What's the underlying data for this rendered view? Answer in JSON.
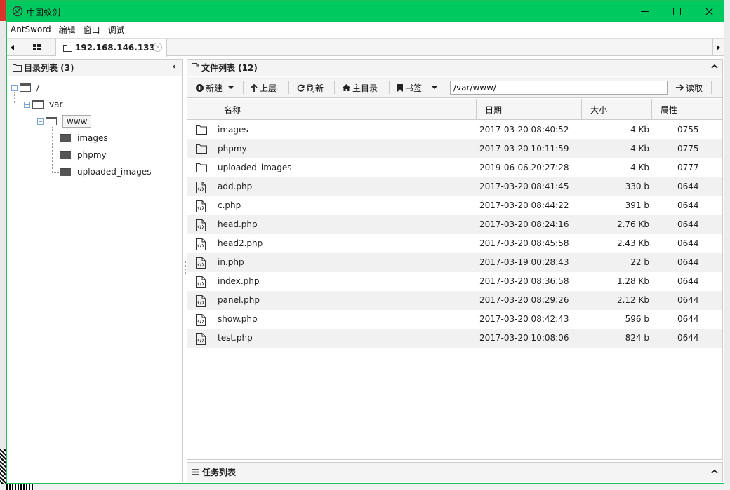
{
  "window": {
    "title": "中国蚁剑",
    "controls": {
      "minimize": "—",
      "maximize": "☐",
      "close": "✕"
    }
  },
  "menu": [
    "AntSword",
    "编辑",
    "窗口",
    "调试"
  ],
  "tabs": {
    "home_icon": "grid-icon",
    "active_label": "192.168.146.133"
  },
  "dir_panel": {
    "title": "目录列表 (3)",
    "tree": {
      "root": "/",
      "var": "var",
      "www": "www",
      "children": [
        "images",
        "phpmy",
        "uploaded_images"
      ]
    }
  },
  "file_panel": {
    "title": "文件列表 (12)",
    "toolbar": {
      "new": "新建",
      "up": "上层",
      "refresh": "刷新",
      "home": "主目录",
      "bookmark": "书签",
      "path": "/var/www/",
      "read": "读取"
    },
    "columns": {
      "name": "名称",
      "date": "日期",
      "size": "大小",
      "perm": "属性"
    },
    "files": [
      {
        "type": "folder",
        "name": "images",
        "date": "2017-03-20 08:40:52",
        "size": "4 Kb",
        "perm": "0755"
      },
      {
        "type": "folder",
        "name": "phpmy",
        "date": "2017-03-20 10:11:59",
        "size": "4 Kb",
        "perm": "0775"
      },
      {
        "type": "folder",
        "name": "uploaded_images",
        "date": "2019-06-06 20:27:28",
        "size": "4 Kb",
        "perm": "0777"
      },
      {
        "type": "file",
        "name": "add.php",
        "date": "2017-03-20 08:41:45",
        "size": "330 b",
        "perm": "0644"
      },
      {
        "type": "file",
        "name": "c.php",
        "date": "2017-03-20 08:44:22",
        "size": "391 b",
        "perm": "0644"
      },
      {
        "type": "file",
        "name": "head.php",
        "date": "2017-03-20 08:24:16",
        "size": "2.76 Kb",
        "perm": "0644"
      },
      {
        "type": "file",
        "name": "head2.php",
        "date": "2017-03-20 08:45:58",
        "size": "2.43 Kb",
        "perm": "0644"
      },
      {
        "type": "file",
        "name": "in.php",
        "date": "2017-03-19 00:28:43",
        "size": "22 b",
        "perm": "0644"
      },
      {
        "type": "file",
        "name": "index.php",
        "date": "2017-03-20 08:36:58",
        "size": "1.28 Kb",
        "perm": "0644"
      },
      {
        "type": "file",
        "name": "panel.php",
        "date": "2017-03-20 08:29:26",
        "size": "2.12 Kb",
        "perm": "0644"
      },
      {
        "type": "file",
        "name": "show.php",
        "date": "2017-03-20 08:42:43",
        "size": "596 b",
        "perm": "0644"
      },
      {
        "type": "file",
        "name": "test.php",
        "date": "2017-03-20 10:08:06",
        "size": "824 b",
        "perm": "0644"
      }
    ]
  },
  "task_panel": {
    "title": "任务列表"
  },
  "colors": {
    "titlebar": "#00c95f",
    "border": "#cccccc",
    "alt_row": "#f1f1f1"
  }
}
